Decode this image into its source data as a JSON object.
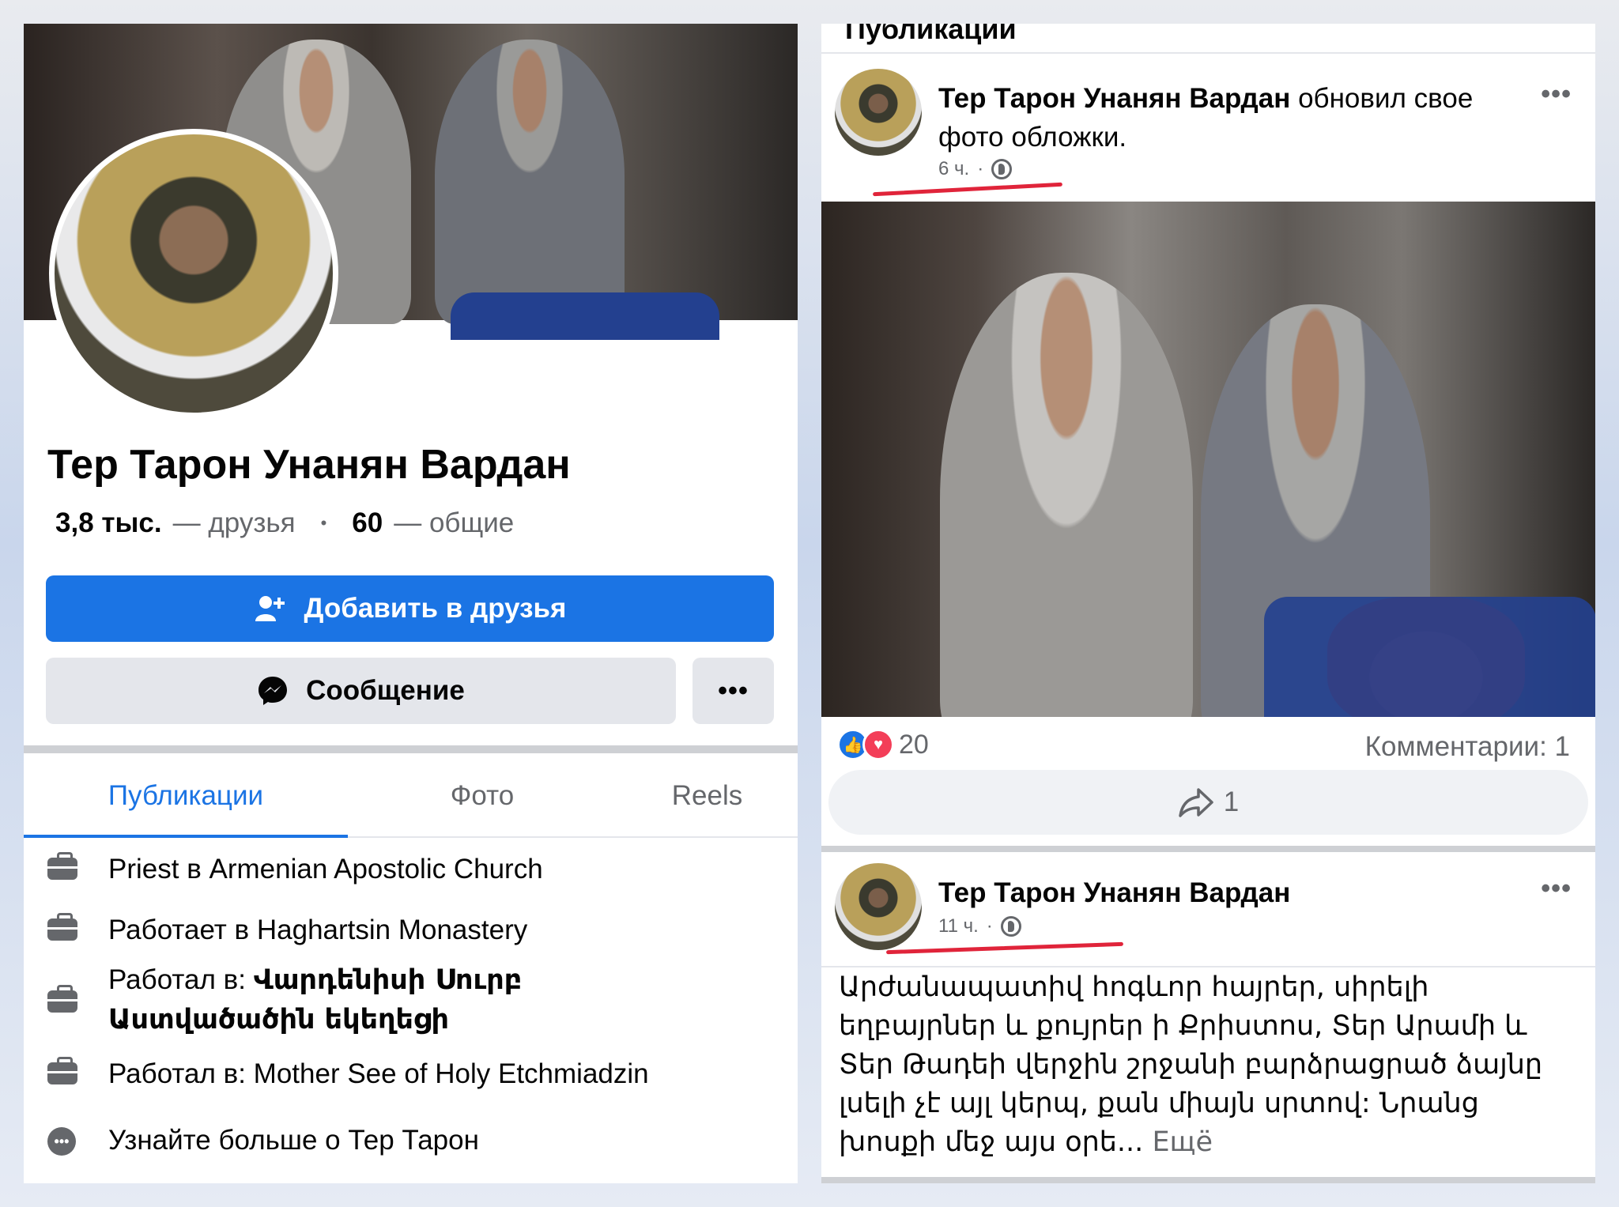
{
  "profile": {
    "name": "Тер Тарон Унанян Вардан",
    "friends_count": "3,8 тыс.",
    "friends_label": "— друзья",
    "separator": "•",
    "mutual_count": "60",
    "mutual_label": "— общие",
    "add_friend_label": "Добавить в друзья",
    "message_label": "Сообщение",
    "more_label": "•••",
    "tabs": [
      {
        "label": "Публикации",
        "active": true
      },
      {
        "label": "Фото",
        "active": false
      },
      {
        "label": "Reels",
        "active": false
      }
    ],
    "info": [
      {
        "icon": "briefcase-icon",
        "text": "Priest в Armenian Apostolic Church"
      },
      {
        "icon": "briefcase-icon",
        "text": "Работает в Haghartsin Monastery"
      },
      {
        "icon": "briefcase-icon",
        "prefix": "Работал в: ",
        "text_bold": "Վարդենիսի Սուրբ Աստվածածին եկեղեցի"
      },
      {
        "icon": "briefcase-icon",
        "text": "Работал в: Mother See of Holy Etchmiadzin"
      },
      {
        "icon": "more-dots-icon",
        "text": "Узнайте больше о Тер Тарон"
      }
    ]
  },
  "feed": {
    "section_title": "Публикации",
    "post1": {
      "author": "Тер Тарон Унанян Вардан",
      "action": " обновил свое фото обложки.",
      "time": "6 ч.",
      "time_sep": "·",
      "more": "•••",
      "reactions_count": "20",
      "comments": "Комментарии: 1",
      "shares": "1",
      "annotation_color": "#e0243a"
    },
    "post2": {
      "author": "Тер Тарон Унанян Вардан",
      "time": "11 ч.",
      "time_sep": "·",
      "more": "•••",
      "text": "Արժանապատիվ հոգևոր հայրեր, սիրելի եղբայրներ և քույրեր ի Քրիստոս, Տեր Արամի և Տեր Թադեի վերջին շրջանի բարձրացրած ձայնը լսելի չէ այլ կերպ, քան միայն սրտով: Նրանց խոսքի մեջ այս օրե...",
      "more_link": " Ещё"
    }
  },
  "colors": {
    "accent": "#1b74e4",
    "text": "#050505",
    "muted": "#65676b",
    "button_gray": "#e4e6eb"
  }
}
